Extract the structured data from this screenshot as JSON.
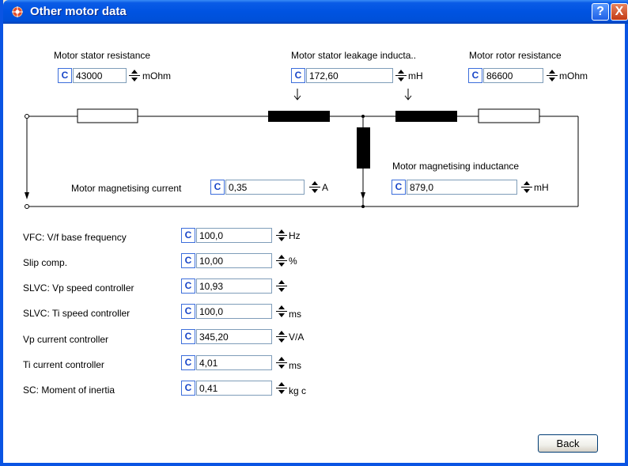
{
  "window": {
    "title": "Other motor data"
  },
  "titlebar_buttons": {
    "help": "?",
    "close": "X"
  },
  "circuit": {
    "stator_resistance": {
      "label": "Motor stator resistance",
      "c": "C",
      "value": "43000",
      "unit": "mOhm"
    },
    "stator_leakage": {
      "label": "Motor stator leakage inducta..",
      "c": "C",
      "value": "172,60",
      "unit": "mH"
    },
    "rotor_resistance": {
      "label": "Motor rotor resistance",
      "c": "C",
      "value": "86600",
      "unit": "mOhm"
    },
    "magnetising_inductance": {
      "label": "Motor magnetising inductance",
      "c": "C",
      "value": "879,0",
      "unit": "mH"
    },
    "magnetising_current": {
      "label": "Motor magnetising current",
      "c": "C",
      "value": "0,35",
      "unit": "A"
    }
  },
  "params": [
    {
      "label": "VFC: V/f base frequency",
      "c": "C",
      "value": "100,0",
      "unit": "Hz"
    },
    {
      "label": "Slip comp.",
      "c": "C",
      "value": "10,00",
      "unit": "%"
    },
    {
      "label": "SLVC: Vp speed controller",
      "c": "C",
      "value": "10,93",
      "unit": ""
    },
    {
      "label": "SLVC: Ti speed controller",
      "c": "C",
      "value": "100,0",
      "unit": "ms"
    },
    {
      "label": "Vp current controller",
      "c": "C",
      "value": "345,20",
      "unit": "V/A"
    },
    {
      "label": "Ti current controller",
      "c": "C",
      "value": "4,01",
      "unit": "ms"
    },
    {
      "label": "SC: Moment of inertia",
      "c": "C",
      "value": "0,41",
      "unit": "kg c"
    }
  ],
  "buttons": {
    "back": "Back"
  }
}
